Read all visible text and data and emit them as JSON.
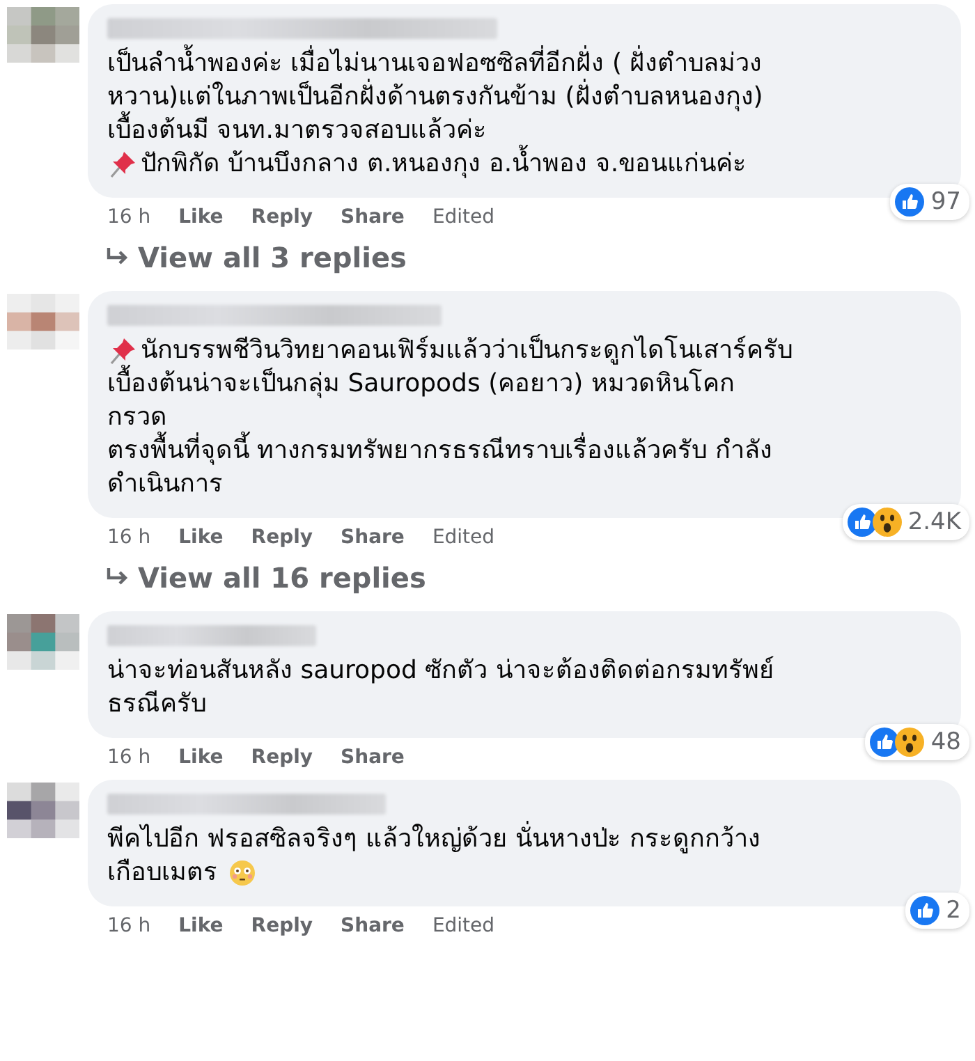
{
  "comments": [
    {
      "lines": [
        {
          "text": "เป็นลำน้ำพองค่ะ เมื่อไม่นานเจอฟอซซิลที่อีกฝั่ง ( ฝั่งตำบลม่วง",
          "kind": "plain"
        },
        {
          "text": "หวาน)แต่ในภาพเป็นอีกฝั่งด้านตรงกันข้าม (ฝั่งตำบลหนองกุง)",
          "kind": "plain"
        },
        {
          "text": "เบื้องต้นมี จนท.มาตรวจสอบแล้วค่ะ",
          "kind": "plain"
        },
        {
          "text": "ปักพิกัด บ้านบึงกลาง ต.หนองกุง อ.น้ำพอง จ.ขอนแก่นค่ะ",
          "kind": "pinned"
        }
      ],
      "time": "16 h",
      "actions": [
        "Like",
        "Reply",
        "Share"
      ],
      "edited": "Edited",
      "reactions": [
        {
          "kind": "like"
        }
      ],
      "reaction_count": "97",
      "replies": "View all 3 replies"
    },
    {
      "lines": [
        {
          "text": "นักบรรพชีวินวิทยาคอนเฟิร์มแล้วว่าเป็นกระดูกไดโนเสาร์ครับ",
          "kind": "pinned"
        },
        {
          "text": "เบื้องต้นน่าจะเป็นกลุ่ม Sauropods (คอยาว) หมวดหินโคก",
          "kind": "plain"
        },
        {
          "text": "กรวด",
          "kind": "plain"
        },
        {
          "text": "ตรงพื้นที่จุดนี้ ทางกรมทรัพยากรธรณีทราบเรื่องแล้วครับ กำลัง",
          "kind": "plain"
        },
        {
          "text": "ดำเนินการ",
          "kind": "plain"
        }
      ],
      "time": "16 h",
      "actions": [
        "Like",
        "Reply",
        "Share"
      ],
      "edited": "Edited",
      "reactions": [
        {
          "kind": "like"
        },
        {
          "kind": "wow"
        }
      ],
      "reaction_count": "2.4K",
      "replies": "View all 16 replies"
    },
    {
      "lines": [
        {
          "text": "น่าจะท่อนสันหลัง sauropod ซักตัว น่าจะต้องติดต่อกรมทรัพย์",
          "kind": "plain"
        },
        {
          "text": "ธรณีครับ",
          "kind": "plain"
        }
      ],
      "time": "16 h",
      "actions": [
        "Like",
        "Reply",
        "Share"
      ],
      "reactions": [
        {
          "kind": "like"
        },
        {
          "kind": "wow"
        }
      ],
      "reaction_count": "48"
    },
    {
      "lines": [
        {
          "text": "พีคไปอีก ฟรอสซิลจริงๆ แล้วใหญ่ด้วย นั่นหางป่ะ กระดูกกว้าง",
          "kind": "plain"
        },
        {
          "text": "เกือบเมตร",
          "kind": "emoji"
        }
      ],
      "time": "16 h",
      "actions": [
        "Like",
        "Reply",
        "Share"
      ],
      "edited": "Edited",
      "reactions": [
        {
          "kind": "like"
        }
      ],
      "reaction_count": "2"
    }
  ]
}
